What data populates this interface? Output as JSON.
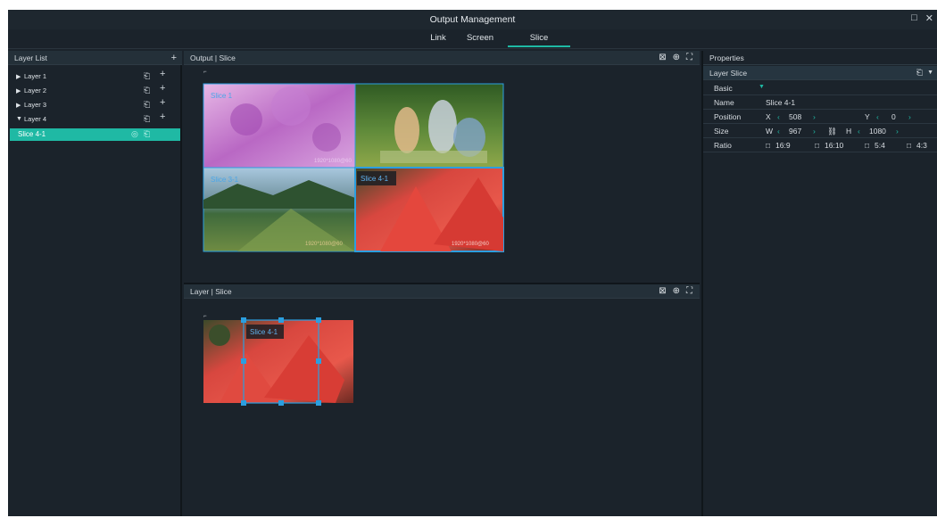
{
  "window": {
    "title": "Output Management",
    "maximize_glyph": "□",
    "close_glyph": "✕"
  },
  "tabs": [
    {
      "label": "Link"
    },
    {
      "label": "Screen"
    },
    {
      "label": "Slice"
    }
  ],
  "active_tab": "Slice",
  "left": {
    "title": "Layer List",
    "add_glyph": "+",
    "layers": [
      {
        "label": "Layer 1",
        "expanded": false
      },
      {
        "label": "Layer 2",
        "expanded": false
      },
      {
        "label": "Layer 3",
        "expanded": false
      },
      {
        "label": "Layer 4",
        "expanded": true
      }
    ],
    "child": {
      "label": "Slice 4-1"
    },
    "glyphs": {
      "collapsed": "▶",
      "expanded": "▼",
      "lock": "⎗",
      "plus": "+",
      "eye": "◎"
    }
  },
  "output_panel": {
    "title": "Output | Slice",
    "slices": [
      {
        "label": "Slice 1",
        "resolution": "1920*1080@60",
        "image": "lilac-flowers"
      },
      {
        "label": "",
        "resolution": "",
        "image": "family-picnic"
      },
      {
        "label": "Slice 3-1",
        "resolution": "1920*1080@60",
        "image": "green-valley"
      },
      {
        "label": "Slice 4-1",
        "resolution": "1920*1080@60",
        "image": "watermelon"
      }
    ]
  },
  "layer_panel": {
    "title": "Layer | Slice",
    "slice_label": "Slice 4-1",
    "image": "watermelon"
  },
  "panel_icons": {
    "fit": "⊠",
    "center": "⊕",
    "fullscreen": "⛶"
  },
  "properties": {
    "title": "Properties",
    "section": "Layer Slice",
    "basic": "Basic",
    "name_label": "Name",
    "name_value": "Slice 4-1",
    "position_label": "Position",
    "x_label": "X",
    "x_value": "508",
    "y_label": "Y",
    "y_value": "0",
    "size_label": "Size",
    "w_label": "W",
    "w_value": "967",
    "h_label": "H",
    "h_value": "1080",
    "ratio_label": "Ratio",
    "ratios": [
      "16:9",
      "16:10",
      "5:4",
      "4:3"
    ],
    "arrow_left": "‹",
    "arrow_right": "›",
    "dropdown": "▼",
    "link_glyph": "⛓",
    "checkbox": "□"
  },
  "colors": {
    "accent": "#1fb9a4",
    "selection_border": "#2b9fe0"
  }
}
